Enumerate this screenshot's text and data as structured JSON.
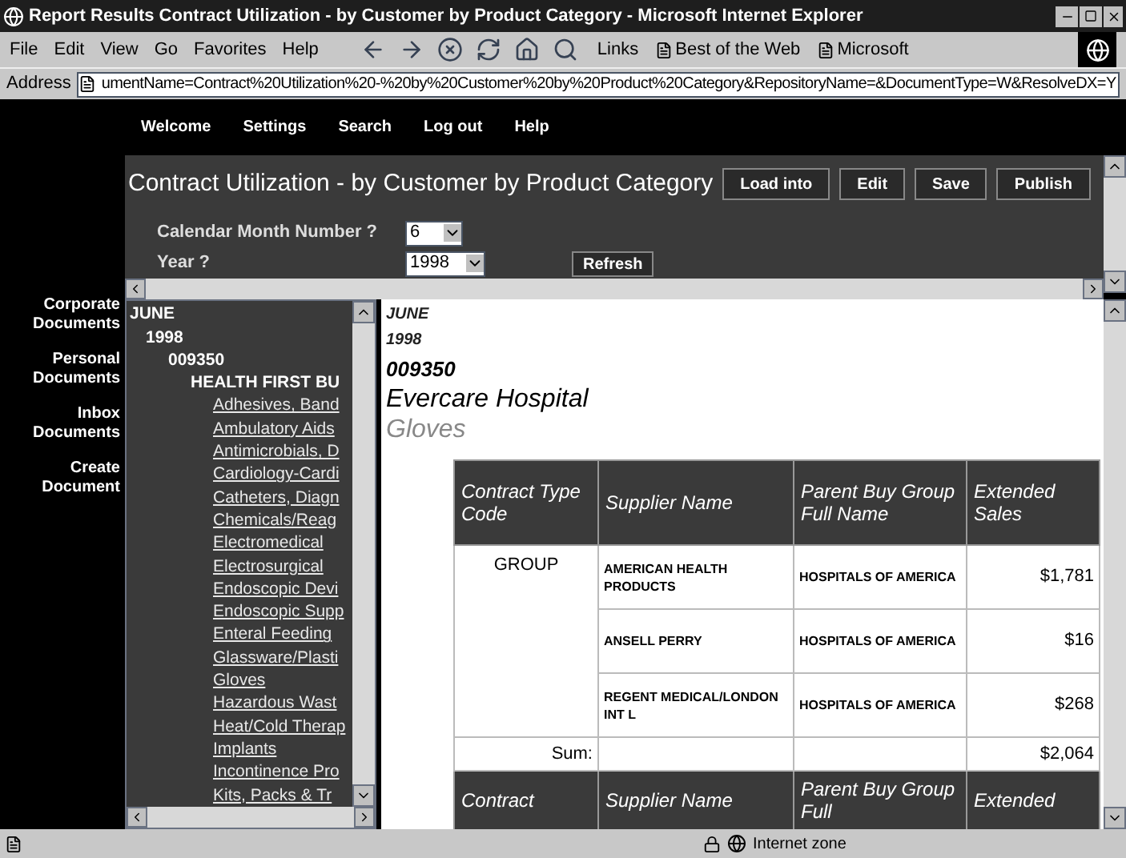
{
  "window": {
    "title": "Report Results Contract Utilization - by Customer by Product Category - Microsoft Internet Explorer"
  },
  "menu": [
    "File",
    "Edit",
    "View",
    "Go",
    "Favorites",
    "Help"
  ],
  "links": {
    "label": "Links",
    "items": [
      "Best of the Web",
      "Microsoft"
    ]
  },
  "address": {
    "label": "Address",
    "value": "umentName=Contract%20Utilization%20-%20by%20Customer%20by%20Product%20Category&RepositoryName=&DocumentType=W&ResolveDX=Y"
  },
  "nav": [
    "Welcome",
    "Settings",
    "Search",
    "Log out",
    "Help"
  ],
  "report": {
    "title": "Contract Utilization - by Customer by Product Category",
    "buttons": [
      "Load into",
      "Edit",
      "Save",
      "Publish"
    ],
    "prompts": [
      {
        "label": "Calendar Month Number ?",
        "value": "6"
      },
      {
        "label": "Year ?",
        "value": "1998"
      }
    ],
    "refresh": "Refresh"
  },
  "sidebar": [
    "Corporate Documents",
    "Personal Documents",
    "Inbox Documents",
    "Create Document"
  ],
  "tree": [
    {
      "label": "JUNE",
      "kind": "node",
      "children": [
        {
          "label": "1998",
          "kind": "node",
          "children": [
            {
              "label": "009350",
              "kind": "node",
              "children": [
                {
                  "label": "HEALTH FIRST BU",
                  "kind": "node",
                  "children": [
                    {
                      "label": "Adhesives, Band",
                      "kind": "link"
                    },
                    {
                      "label": "Ambulatory Aids",
                      "kind": "link"
                    },
                    {
                      "label": "Antimicrobials, D",
                      "kind": "link"
                    },
                    {
                      "label": "Cardiology-Cardi",
                      "kind": "link"
                    },
                    {
                      "label": "Catheters, Diagn",
                      "kind": "link"
                    },
                    {
                      "label": "Chemicals/Reag",
                      "kind": "link"
                    },
                    {
                      "label": "Electromedical",
                      "kind": "link"
                    },
                    {
                      "label": "Electrosurgical",
                      "kind": "link"
                    },
                    {
                      "label": "Endoscopic Devi",
                      "kind": "link"
                    },
                    {
                      "label": "Endoscopic Supp",
                      "kind": "link"
                    },
                    {
                      "label": "Enteral Feeding",
                      "kind": "link"
                    },
                    {
                      "label": "Glassware/Plasti",
                      "kind": "link"
                    },
                    {
                      "label": "Gloves",
                      "kind": "link"
                    },
                    {
                      "label": "Hazardous Wast",
                      "kind": "link"
                    },
                    {
                      "label": "Heat/Cold Therap",
                      "kind": "link"
                    },
                    {
                      "label": "Implants",
                      "kind": "link"
                    },
                    {
                      "label": "Incontinence Pro",
                      "kind": "link"
                    },
                    {
                      "label": "Kits, Packs & Tr",
                      "kind": "link"
                    }
                  ]
                }
              ]
            }
          ]
        }
      ]
    }
  ],
  "breadcrumb": {
    "month": "JUNE",
    "year": "1998",
    "customer_id": "009350",
    "customer": "Evercare Hospital",
    "category": "Gloves"
  },
  "table": {
    "columns": [
      "Contract Type Code",
      "Supplier Name",
      "Parent Buy Group Full Name",
      "Extended Sales"
    ],
    "group": "GROUP",
    "rows": [
      {
        "supplier": "AMERICAN HEALTH PRODUCTS",
        "parent": "HOSPITALS OF AMERICA",
        "sales": "$1,781"
      },
      {
        "supplier": "ANSELL PERRY",
        "parent": "HOSPITALS OF AMERICA",
        "sales": "$16"
      },
      {
        "supplier": "REGENT MEDICAL/LONDON INT L",
        "parent": "HOSPITALS OF AMERICA",
        "sales": "$268"
      }
    ],
    "sum_label": "Sum:",
    "sum": "$2,064"
  },
  "next_table_columns": [
    "Contract",
    "Supplier Name",
    "Parent Buy Group Full",
    "Extended"
  ],
  "status_bar": {
    "zone": "Internet zone"
  }
}
